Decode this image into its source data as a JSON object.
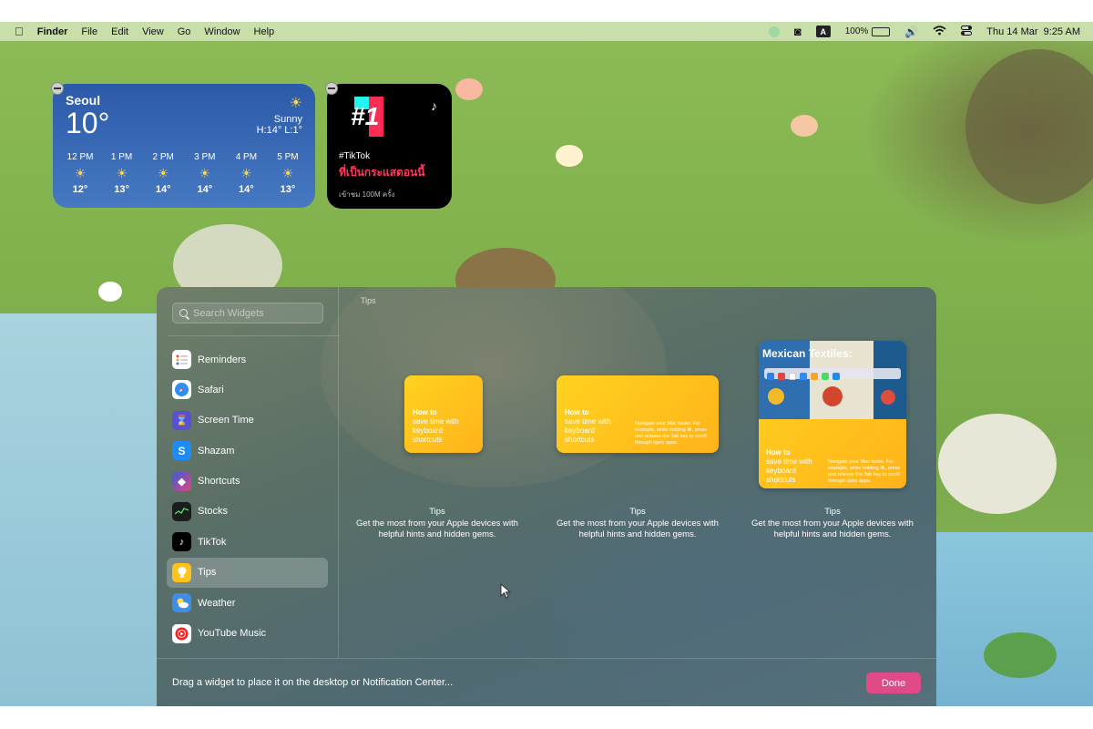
{
  "menubar": {
    "app_name": "Finder",
    "menus": [
      "File",
      "Edit",
      "View",
      "Go",
      "Window",
      "Help"
    ],
    "input_source": "A",
    "battery_percent": "100%",
    "battery_level": 1.0,
    "datetime": "Thu 14 Mar  9:25 AM"
  },
  "weather_widget": {
    "city": "Seoul",
    "temperature": "10°",
    "condition": "Sunny",
    "high_low": "H:14° L:1°",
    "hourly": [
      {
        "time": "12 PM",
        "temp": "12°"
      },
      {
        "time": "1 PM",
        "temp": "13°"
      },
      {
        "time": "2 PM",
        "temp": "14°"
      },
      {
        "time": "3 PM",
        "temp": "14°"
      },
      {
        "time": "4 PM",
        "temp": "14°"
      },
      {
        "time": "5 PM",
        "temp": "13°"
      }
    ]
  },
  "tiktok_widget": {
    "rank": "#1",
    "hashtag": "#TikTok",
    "headline": "ที่เป็นกระแสตอนนี้",
    "views": "เข้าชม 100M ครั้ง"
  },
  "gallery": {
    "search_placeholder": "Search Widgets",
    "section_title": "Tips",
    "apps": [
      {
        "label": "Reminders",
        "icon": "reminders-icon",
        "color": "#ffffff"
      },
      {
        "label": "Safari",
        "icon": "safari-icon",
        "color": "#2f8cf0"
      },
      {
        "label": "Screen Time",
        "icon": "hourglass-icon",
        "color": "#5b4fd6"
      },
      {
        "label": "Shazam",
        "icon": "shazam-icon",
        "color": "#1d8cf5"
      },
      {
        "label": "Shortcuts",
        "icon": "shortcuts-icon",
        "color": "#e0467a"
      },
      {
        "label": "Stocks",
        "icon": "stocks-icon",
        "color": "#1c1c1e"
      },
      {
        "label": "TikTok",
        "icon": "tiktok-icon",
        "color": "#000000"
      },
      {
        "label": "Tips",
        "icon": "lightbulb-icon",
        "color": "#ffc21a"
      },
      {
        "label": "Weather",
        "icon": "weather-icon",
        "color": "#3d8ee6"
      },
      {
        "label": "YouTube Music",
        "icon": "youtube-music-icon",
        "color": "#ff1f1f"
      }
    ],
    "selected_app": "Tips",
    "tip_card_text": {
      "line1": "How to",
      "line2": "save time with",
      "line3": "keyboard",
      "line4": "shortcuts",
      "detail": "Navigate your Mac faster. For example, while holding ⌘, press and release the Tab key to scroll through open apps."
    },
    "large_card_headline": "Mexican Textiles:",
    "previews": [
      {
        "name": "Tips",
        "description": "Get the most from your Apple devices with helpful hints and hidden gems."
      },
      {
        "name": "Tips",
        "description": "Get the most from your Apple devices with helpful hints and hidden gems."
      },
      {
        "name": "Tips",
        "description": "Get the most from your Apple devices with helpful hints and hidden gems."
      }
    ],
    "footer_hint": "Drag a widget to place it on the desktop or Notification Center...",
    "done_label": "Done"
  },
  "colors": {
    "accent_done": "#e04a86",
    "tip_yellow": "#ffc21a",
    "weather_blue": "#2c5aa9"
  }
}
